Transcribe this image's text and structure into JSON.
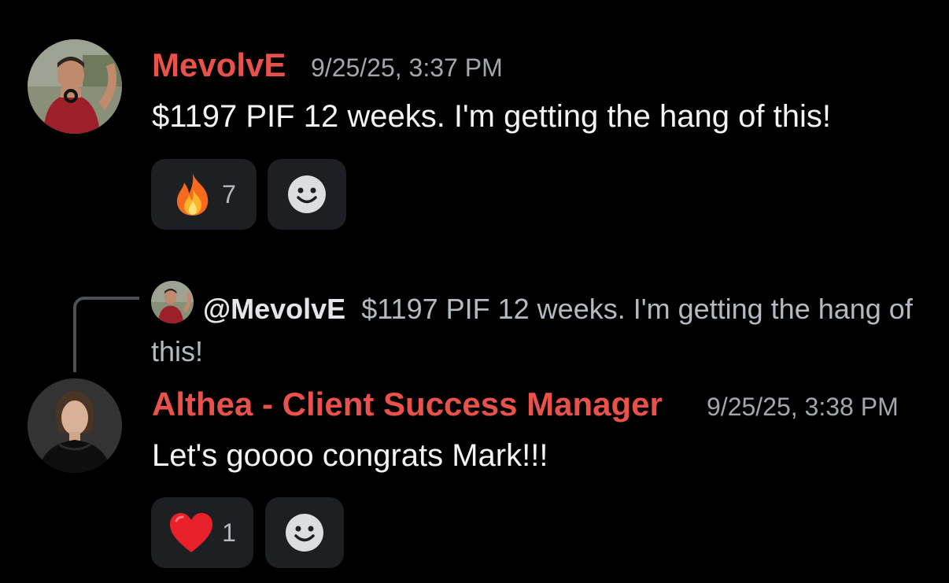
{
  "messages": [
    {
      "author": "MevolvE",
      "timestamp": "9/25/25, 3:37 PM",
      "text": "$1197 PIF 12 weeks. I'm getting the hang of this!",
      "reactions": [
        {
          "emoji": "fire",
          "count": "7"
        },
        {
          "emoji": "add-reaction",
          "count": ""
        }
      ]
    },
    {
      "reply_to": {
        "mention": "@MevolvE",
        "preview": "$1197 PIF 12 weeks. I'm getting the hang of this!"
      },
      "author": "Althea - Client Success Manager",
      "timestamp": "9/25/25, 3:38 PM",
      "text": "Let's goooo congrats Mark!!!",
      "reactions": [
        {
          "emoji": "red-heart",
          "count": "1"
        },
        {
          "emoji": "add-reaction",
          "count": ""
        }
      ]
    }
  ],
  "colors": {
    "background": "#000000",
    "username": "#e8524a",
    "reaction_bg": "#1e1f22"
  }
}
